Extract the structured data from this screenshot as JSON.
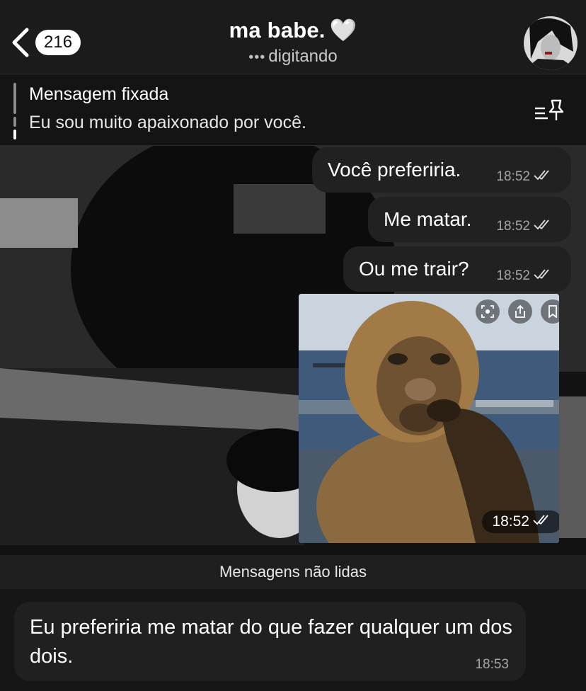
{
  "header": {
    "back_count": "216",
    "title": "ma babe.",
    "title_emoji": "🤍",
    "status_dots": "•••",
    "status": "digitando"
  },
  "pinned": {
    "label": "Mensagem fixada",
    "text": "Eu sou muito apaixonado por você."
  },
  "messages": [
    {
      "text": "Você preferiria.",
      "time": "18:52"
    },
    {
      "text": "Me matar.",
      "time": "18:52"
    },
    {
      "text": "Ou me trair?",
      "time": "18:52"
    }
  ],
  "photo_message": {
    "time": "18:52"
  },
  "unread_divider": "Mensagens não lidas",
  "incoming": {
    "text": "Eu preferiria me matar do que fazer qualquer um dos dois.",
    "time": "18:53"
  },
  "colors": {
    "header_bg": "#1b1b1b",
    "bubble_bg": "#212121",
    "meta_text": "#a6a6a6"
  },
  "icons": [
    "chevron-left-icon",
    "pin-list-icon",
    "read-ticks-icon",
    "scan-icon",
    "share-icon",
    "bookmark-icon"
  ]
}
